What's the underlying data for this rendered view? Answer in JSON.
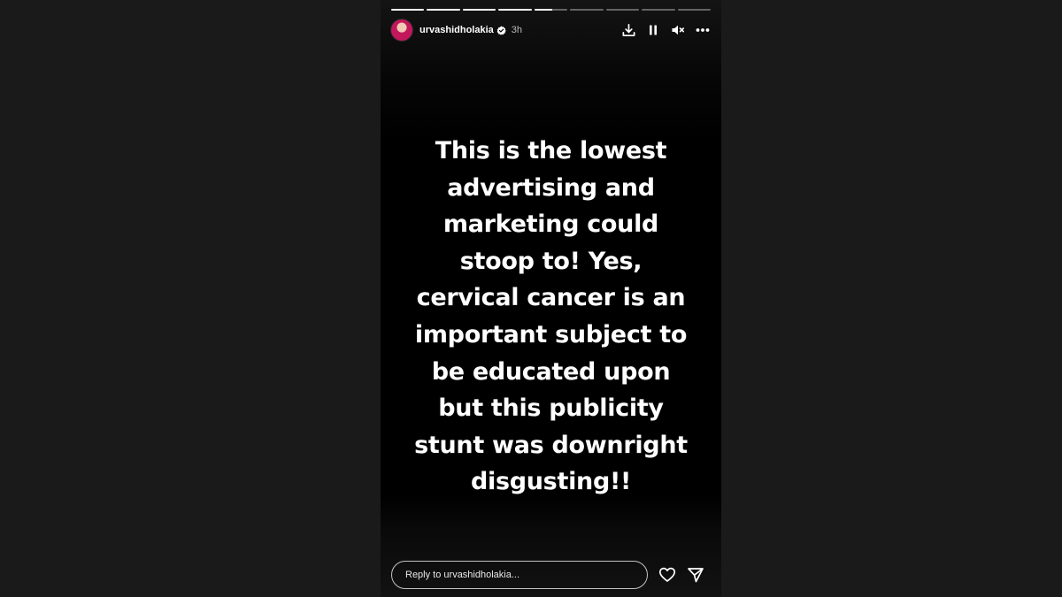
{
  "story": {
    "progress": [
      1,
      1,
      1,
      1,
      0.55,
      0,
      0,
      0,
      0
    ],
    "user": {
      "username": "urvashidholakia",
      "verified_icon": "verified-badge-icon",
      "time": "3h"
    },
    "controls": [
      "download-icon",
      "pause-icon",
      "mute-icon",
      "more-icon"
    ],
    "text": "This is the lowest\nadvertising and\nmarketing could\nstoop to! Yes,\ncervical cancer is an\nimportant subject to\nbe educated upon\nbut this publicity\nstunt was downright\ndisgusting!!",
    "reply": {
      "placeholder": "Reply to urvashidholakia..."
    },
    "actions": [
      "heart-icon",
      "send-icon"
    ]
  },
  "colors": {
    "page_background": "#1a1a1a",
    "story_background": "#000000",
    "text": "#ffffff"
  }
}
